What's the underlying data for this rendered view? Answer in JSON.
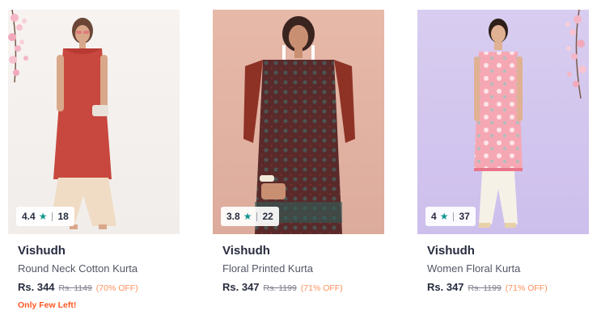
{
  "products": [
    {
      "brand": "Vishudh",
      "name": "Round Neck Cotton Kurta",
      "rating": "4.4",
      "rating_count": "18",
      "price": "Rs. 344",
      "mrp": "Rs. 1149",
      "discount": "(70% OFF)",
      "stock_note": "Only Few Left!",
      "image_alt": "red sleeveless kurta"
    },
    {
      "brand": "Vishudh",
      "name": "Floral Printed Kurta",
      "rating": "3.8",
      "rating_count": "22",
      "price": "Rs. 347",
      "mrp": "Rs. 1199",
      "discount": "(71% OFF)",
      "image_alt": "maroon printed kurta"
    },
    {
      "brand": "Vishudh",
      "name": "Women Floral Kurta",
      "rating": "4",
      "rating_count": "37",
      "price": "Rs. 347",
      "mrp": "Rs. 1199",
      "discount": "(71% OFF)",
      "image_alt": "pink floral kurta"
    }
  ],
  "icons": {
    "rating_star": "star-icon"
  },
  "colors": {
    "star": "#14958f",
    "discount": "#ff905a",
    "stock_note": "#ff5722",
    "brand_text": "#282c3f",
    "name_text": "#535766"
  }
}
